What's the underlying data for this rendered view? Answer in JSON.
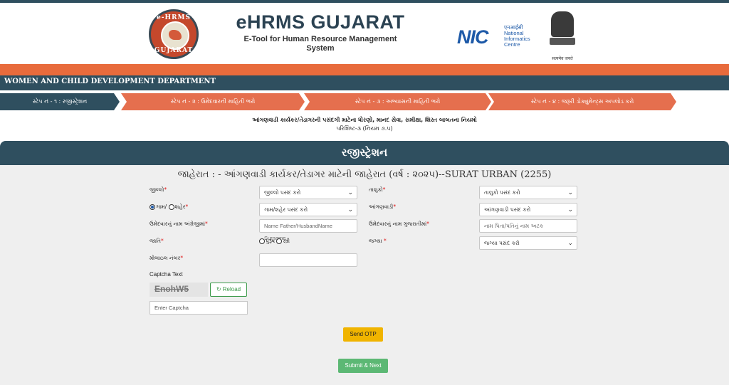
{
  "header": {
    "title": "eHRMS GUJARAT",
    "subtitle_line1": "E-Tool for Human Resource Management",
    "subtitle_line2": "System",
    "logo_top_text": "e-HRMS",
    "logo_bottom_text": "GUJARAT",
    "nic_letters": "NIC",
    "nic_hindi": "एनआईसी",
    "nic_line1": "National",
    "nic_line2": "Informatics",
    "nic_line3": "Centre",
    "emblem_motto": "सत्यमेव जयते"
  },
  "department": "WOMEN AND CHILD DEVELOPMENT DEPARTMENT",
  "steps": [
    {
      "label": "સ્ટેપ નં - ૧ : રજીસ્ટ્રેશન"
    },
    {
      "label": "સ્ટેપ નં - ૨ : ઉમેદવારની માહિતી ભરો"
    },
    {
      "label": "સ્ટેપ નં - ૩ : અભ્યાસની માહિતી ભરો"
    },
    {
      "label": "સ્ટેપ નં - ૪ : જરૂરી ડોક્યુમેન્ટ્સ અપલોડ કરો"
    }
  ],
  "rules": {
    "line1": "આંગણવાડી કાર્યકર/તેડાગરની પસંદગી માટેના ધોરણો, માનદ સેવા, સમીક્ષા, શિસ્ત બાબતના નિયમો",
    "line2": "પરિશિષ્ટ-૩ (નિયમ ૭.૫)"
  },
  "registration": {
    "heading": "રજીસ્ટ્રેશન",
    "ad_title": "જાહેરાત :   - આંગણવાડી કાર્યકર/તેડાગર માટેની જાહેરાત (વર્ષ : ૨૦૨૫)--SURAT URBAN (2255)"
  },
  "form": {
    "district_label": "જીલ્લો",
    "district_value": "જીલ્લો પસંદ કરો",
    "taluka_label": "તાલુકો",
    "taluka_value": "તાલુકો પસંદ કરો",
    "radio_village": "ગામ/",
    "radio_city": "શહેર",
    "village_value": "ગામ/શહેર પસંદ કરો",
    "anganwadi_label": "આંગણવાડી",
    "anganwadi_value": "આંગણવાડી પસંદ કરો",
    "name_en_label": "ઉમેદવારનું નામ અંગ્રેજીમાં",
    "name_en_placeholder": "Name Father/HusbandName Surname",
    "name_gu_label": "ઉમેદવારનું નામ ગુજરાતીમાં",
    "name_gu_placeholder": "નામ પિતા/પતિનું નામ અટક",
    "gender_label": "જાતિ",
    "gender_male": "પુરૂષ",
    "gender_female": "સ્ત્રી",
    "post_label": "જગ્યા",
    "post_value": "જગ્યા પસંદ કરો",
    "mobile_label": "મોબાઇલ નંબર",
    "mobile_value": "",
    "captcha_label": "Captcha Text",
    "captcha_text": "EnohW5",
    "reload_label": "Reload",
    "captcha_placeholder": "Enter Captcha",
    "send_otp": "Send OTP",
    "submit": "Submit & Next"
  },
  "colors": {
    "dark_teal": "#2f4f5f",
    "orange": "#e86b3c",
    "step_orange": "#e56f4e",
    "otp_yellow": "#f0b400",
    "submit_green": "#5cb874"
  }
}
